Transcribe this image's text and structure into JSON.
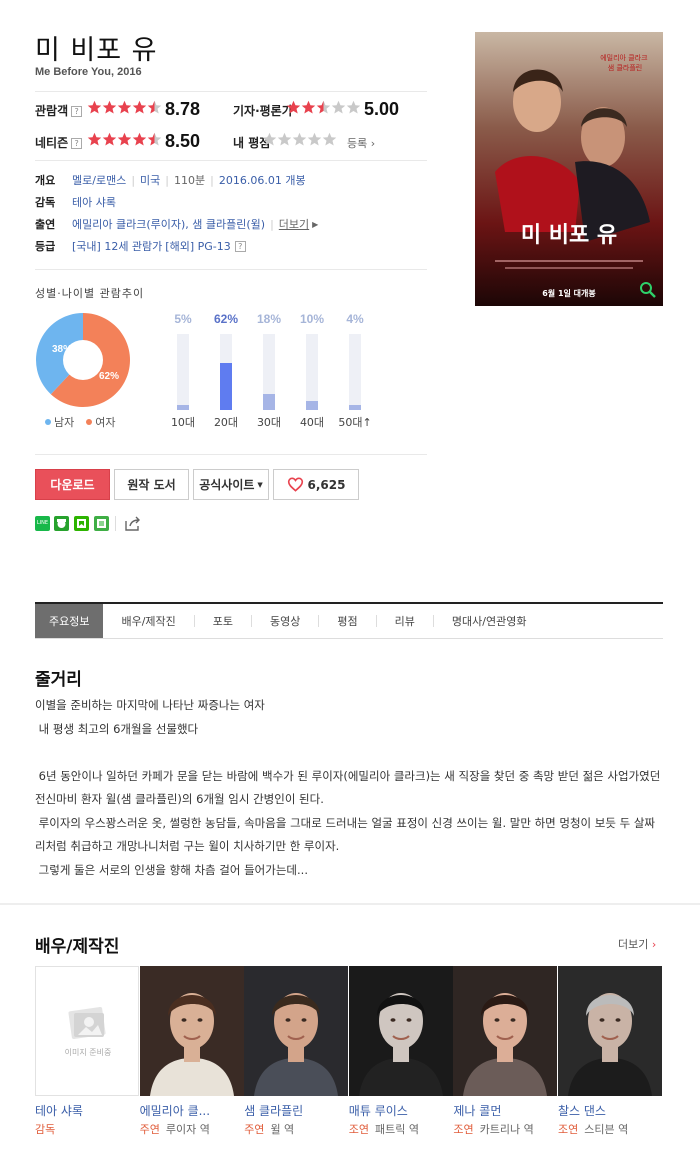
{
  "movie": {
    "title": "미 비포 유",
    "subtitle": "Me Before You, 2016"
  },
  "ratings": {
    "audience_label": "관람객",
    "audience_score": "8.78",
    "audience_stars": 4.5,
    "critic_label": "기자·평론가",
    "critic_score": "5.00",
    "critic_stars": 2.5,
    "netizen_label": "네티즌",
    "netizen_score": "8.50",
    "netizen_stars": 4.5,
    "my_label": "내 평점",
    "register": "등록",
    "help_glyph": "?"
  },
  "info": {
    "overview_key": "개요",
    "genre": "멜로/로맨스",
    "country": "미국",
    "runtime": "110분",
    "release": "2016.06.01 개봉",
    "director_key": "감독",
    "director": "테아 샤록",
    "cast_key": "출연",
    "cast": "에밀리아 클라크(루이자), 샘 클라플린(윌)",
    "more": "더보기",
    "grade_key": "등급",
    "grade_kr": "[국내] 12세 관람가",
    "grade_abroad": "[해외] PG-13"
  },
  "trend": {
    "title": "성별·나이별 관람추이",
    "male_pct": 38,
    "female_pct": 62,
    "male_label": "38%",
    "female_label": "62%",
    "legend_male": "남자",
    "legend_female": "여자",
    "colors": {
      "male": "#6eb5ef",
      "female": "#f38159"
    }
  },
  "chart_data": {
    "type": "bar",
    "categories": [
      "10대",
      "20대",
      "30대",
      "40대",
      "50대↑"
    ],
    "values": [
      5,
      62,
      18,
      10,
      4
    ],
    "labels": [
      "5%",
      "62%",
      "18%",
      "10%",
      "4%"
    ]
  },
  "buttons": {
    "download": "다운로드",
    "book": "원작 도서",
    "site": "공식사이트",
    "likes": "6,625"
  },
  "tabs": [
    "주요정보",
    "배우/제작진",
    "포토",
    "동영상",
    "평점",
    "리뷰",
    "명대사/연관영화"
  ],
  "synopsis": {
    "heading": "줄거리",
    "lines": [
      "이별을 준비하는 마지막에 나타난 짜증나는 여자",
      " 내 평생 최고의 6개월을 선물했다",
      "",
      " 6년 동안이나 일하던 카페가 문을 닫는 바람에 백수가 된 루이자(에밀리아 클라크)는 새 직장을 찾던 중 촉망 받던 젊은 사업가였던 전신마비 환자 윌(샘 클라플린)의 6개월 임시 간병인이 된다.",
      " 루이자의 우스꽝스러운 옷, 썰렁한 농담들, 속마음을 그대로 드러내는 얼굴 표정이 신경 쓰이는 윌. 말만 하면 멍청이 보듯 두 살짜리처럼 취급하고 개망나니처럼 구는 윌이 치사하기만 한 루이자.",
      " 그렇게 둘은 서로의 인생을 향해 차츰 걸어 들어가는데..."
    ]
  },
  "cast_section": {
    "heading": "배우/제작진",
    "more": "더보기",
    "no_image": "이미지 준비중",
    "people": [
      {
        "name": "테아 샤록",
        "role": "감독",
        "character": ""
      },
      {
        "name": "에밀리아 클...",
        "role": "주연",
        "character": "루이자 역"
      },
      {
        "name": "샘 클라플린",
        "role": "주연",
        "character": "윌 역"
      },
      {
        "name": "매튜 루이스",
        "role": "조연",
        "character": "패트릭 역"
      },
      {
        "name": "제나 콜먼",
        "role": "조연",
        "character": "카트리나 역"
      },
      {
        "name": "찰스 댄스",
        "role": "조연",
        "character": "스티븐 역"
      }
    ]
  },
  "poster": {
    "title": "미 비포 유",
    "stars_text": "에밀리아 클라크\n샘 클라플린",
    "date_text": "6월 1일 대개봉"
  }
}
